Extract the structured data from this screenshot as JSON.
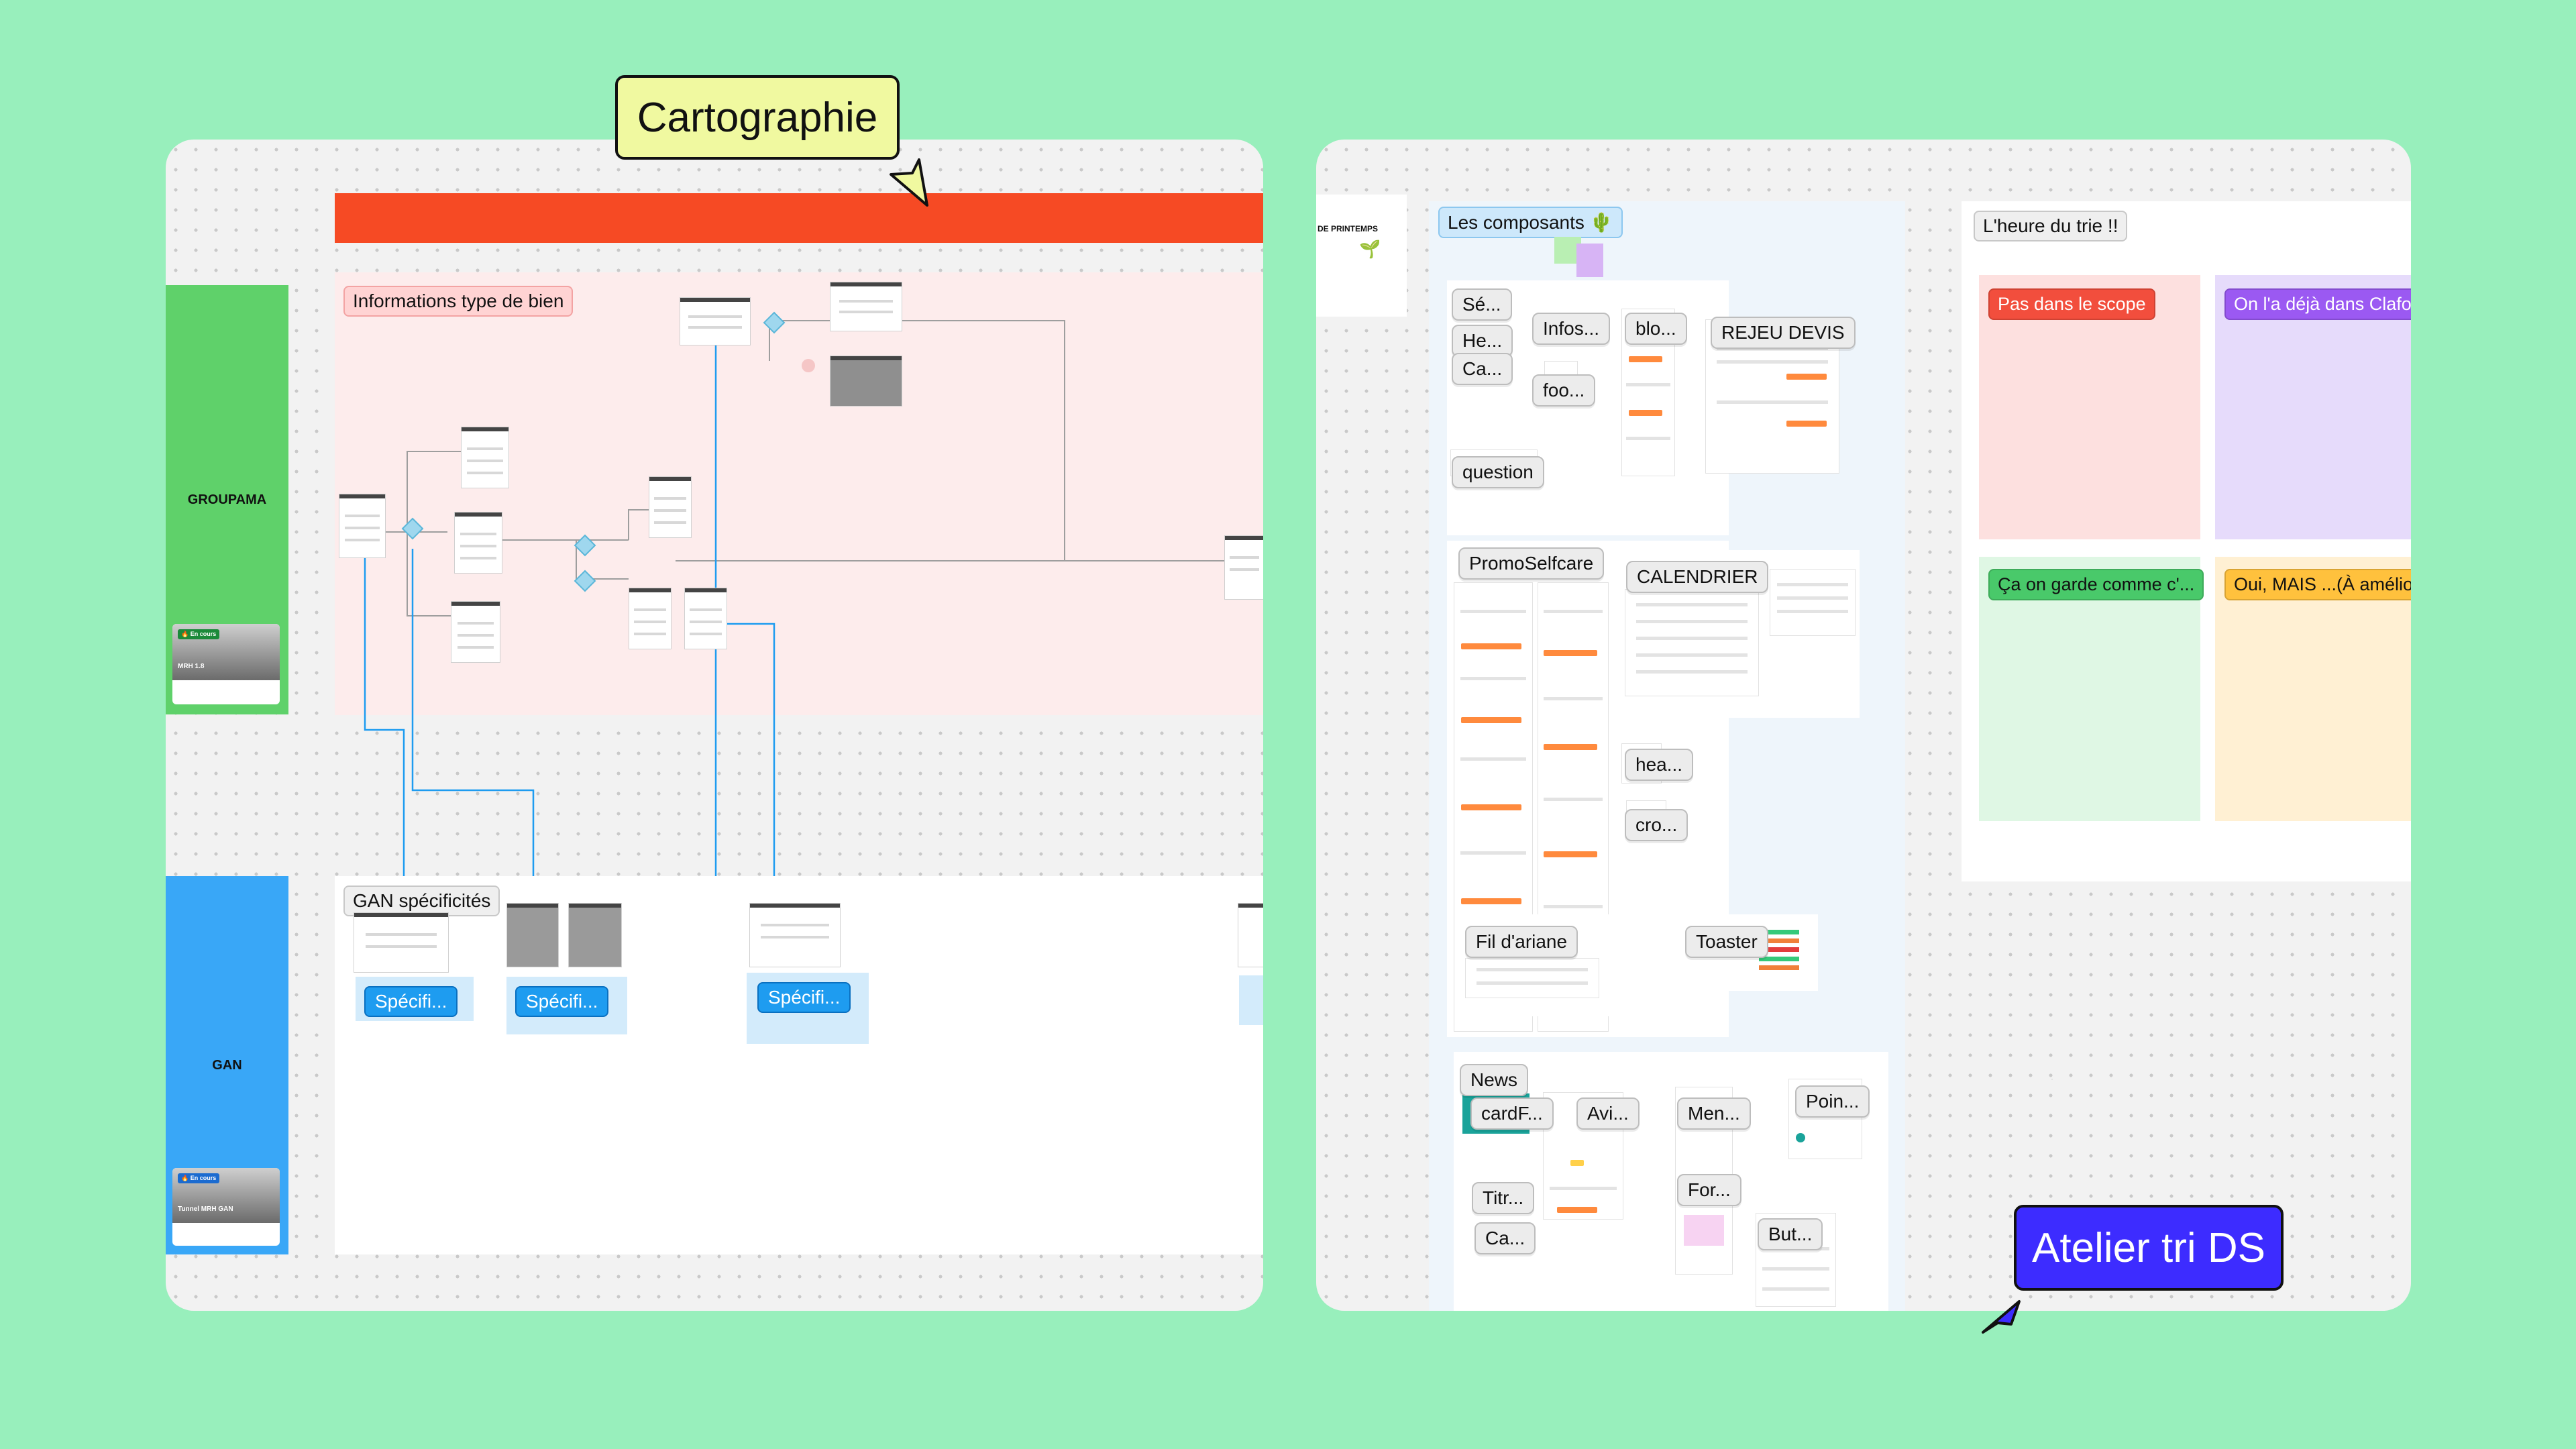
{
  "left_board": {
    "tag": "Cartographie",
    "lanes": [
      {
        "label": "GROUPAMA",
        "card_badge": "🔥 En cours",
        "card_title": "MRH 1.8",
        "color": "#5fd16a"
      },
      {
        "label": "GAN",
        "card_badge": "🔥 En cours",
        "card_title": "Tunnel MRH GAN",
        "color": "#39a7f7"
      }
    ],
    "sections": {
      "info_title": "Informations type de bien",
      "gan_title": "GAN spécificités"
    },
    "spec_tags": [
      "Spécifi...",
      "Spécifi...",
      "Spécifi..."
    ],
    "colors": {
      "banner": "#f64a24",
      "pink_section": "#fdecec",
      "spec_blue": "#1e9cf0"
    }
  },
  "right_board": {
    "tag": "Atelier tri DS",
    "colors": {
      "tag_bg": "#3d2cff"
    },
    "printemps_label": "DE PRINTEMPS",
    "composants_title": "Les composants 🌵",
    "component_labels": {
      "se": "Sé...",
      "he": "He...",
      "ca": "Ca...",
      "infos": "Infos...",
      "foo": "foo...",
      "blo": "blo...",
      "rejeu": "REJEU DEVIS",
      "question": "question",
      "promo": "PromoSelfcare",
      "calendrier": "CALENDRIER",
      "hea": "hea...",
      "cro": "cro...",
      "fil": "Fil d'ariane",
      "toaster": "Toaster",
      "news": "News",
      "cardf": "cardF...",
      "avi": "Avi...",
      "men": "Men...",
      "poin": "Poin...",
      "for": "For...",
      "titr": "Titr...",
      "ca2": "Ca...",
      "but": "But..."
    },
    "tri_title": "L'heure du trie !!",
    "columns": [
      {
        "label": "Pas dans le scope",
        "bg": "#fde0df",
        "tag_bg": "#f24e3d"
      },
      {
        "label": "On l'a déjà dans Clafo...",
        "bg": "#e6dbfb",
        "tag_bg": "#9b59f2"
      },
      {
        "label": "Ça on garde comme c'...",
        "bg": "#dff7e4",
        "tag_bg": "#49c96a"
      },
      {
        "label": "Oui, MAIS ...(À amélior...",
        "bg": "#fff0d3",
        "tag_bg": "#ffc13d"
      }
    ]
  }
}
